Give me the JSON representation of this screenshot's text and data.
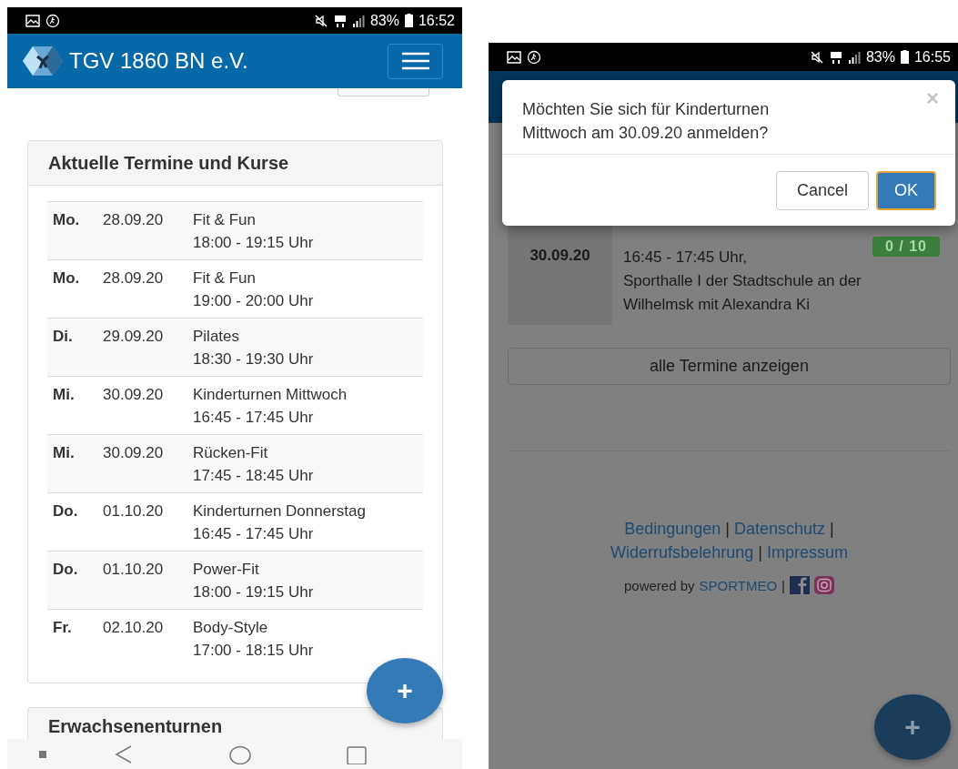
{
  "left_screen": {
    "status_bar": {
      "battery": "83%",
      "time": "16:52"
    },
    "header": {
      "title": "TGV 1860 BN e.V."
    },
    "card": {
      "title": "Aktuelle Termine und Kurse",
      "rows": [
        {
          "day": "Mo.",
          "date": "28.09.20",
          "course": "Fit & Fun",
          "time": "18:00 - 19:15 Uhr"
        },
        {
          "day": "Mo.",
          "date": "28.09.20",
          "course": "Fit & Fun",
          "time": "19:00 - 20:00 Uhr"
        },
        {
          "day": "Di.",
          "date": "29.09.20",
          "course": "Pilates",
          "time": "18:30 - 19:30 Uhr"
        },
        {
          "day": "Mi.",
          "date": "30.09.20",
          "course": "Kinderturnen Mittwoch",
          "time": "16:45 - 17:45 Uhr"
        },
        {
          "day": "Mi.",
          "date": "30.09.20",
          "course": "Rücken-Fit",
          "time": "17:45 - 18:45 Uhr"
        },
        {
          "day": "Do.",
          "date": "01.10.20",
          "course": "Kinderturnen Donnerstag",
          "time": "16:45 - 17:45 Uhr"
        },
        {
          "day": "Do.",
          "date": "01.10.20",
          "course": "Power-Fit",
          "time": "18:00 - 19:15 Uhr"
        },
        {
          "day": "Fr.",
          "date": "02.10.20",
          "course": "Body-Style",
          "time": "17:00 - 18:15 Uhr"
        }
      ]
    },
    "next_card": {
      "title": "Erwachsenenturnen"
    },
    "fab": "+"
  },
  "right_screen": {
    "status_bar": {
      "battery": "83%",
      "time": "16:55"
    },
    "dialog": {
      "message": "Möchten Sie sich für Kinderturnen Mittwoch am 30.09.20 anmelden?",
      "close": "×",
      "buttons": [
        {
          "label": "Cancel",
          "kind": "default"
        },
        {
          "label": "OK",
          "kind": "primary"
        }
      ]
    },
    "event": {
      "date": "30.09.20",
      "badge": "0 / 10",
      "lines": [
        "16:45 - 17:45 Uhr,",
        "Sporthalle I der Stadtschule an der",
        "Wilhelmsk mit Alexandra Ki"
      ]
    },
    "all_button": "alle Termine anzeigen",
    "footer": {
      "links": [
        {
          "kind": "link",
          "text": "Bedingungen"
        },
        {
          "kind": "separator",
          "text": "|"
        },
        {
          "kind": "link",
          "text": "Datenschutz"
        },
        {
          "kind": "separator",
          "text": "|"
        },
        {
          "kind": "link",
          "text": "Widerrufsbelehrung"
        },
        {
          "kind": "separator",
          "text": "|"
        },
        {
          "kind": "link",
          "text": "Impressum"
        }
      ],
      "powered_by": "powered by",
      "brand": "SPORTMEO",
      "separator": "|"
    },
    "fab": "+"
  }
}
